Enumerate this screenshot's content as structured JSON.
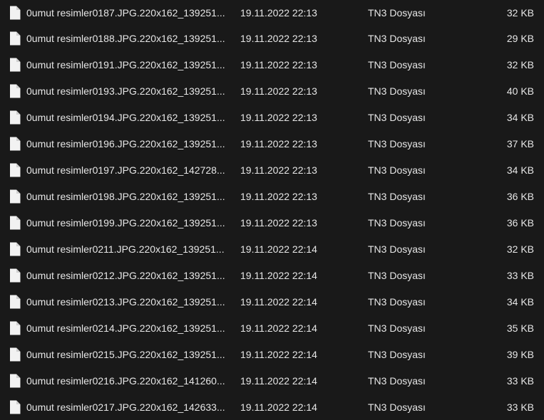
{
  "files": [
    {
      "name": "0umut resimler0187.JPG.220x162_139251...",
      "date": "19.11.2022 22:13",
      "type": "TN3 Dosyası",
      "size": "32 KB",
      "icon": "document-icon"
    },
    {
      "name": "0umut resimler0188.JPG.220x162_139251...",
      "date": "19.11.2022 22:13",
      "type": "TN3 Dosyası",
      "size": "29 KB",
      "icon": "document-icon"
    },
    {
      "name": "0umut resimler0191.JPG.220x162_139251...",
      "date": "19.11.2022 22:13",
      "type": "TN3 Dosyası",
      "size": "32 KB",
      "icon": "document-icon"
    },
    {
      "name": "0umut resimler0193.JPG.220x162_139251...",
      "date": "19.11.2022 22:13",
      "type": "TN3 Dosyası",
      "size": "40 KB",
      "icon": "document-icon"
    },
    {
      "name": "0umut resimler0194.JPG.220x162_139251...",
      "date": "19.11.2022 22:13",
      "type": "TN3 Dosyası",
      "size": "34 KB",
      "icon": "document-icon"
    },
    {
      "name": "0umut resimler0196.JPG.220x162_139251...",
      "date": "19.11.2022 22:13",
      "type": "TN3 Dosyası",
      "size": "37 KB",
      "icon": "document-icon"
    },
    {
      "name": "0umut resimler0197.JPG.220x162_142728...",
      "date": "19.11.2022 22:13",
      "type": "TN3 Dosyası",
      "size": "34 KB",
      "icon": "document-icon"
    },
    {
      "name": "0umut resimler0198.JPG.220x162_139251...",
      "date": "19.11.2022 22:13",
      "type": "TN3 Dosyası",
      "size": "36 KB",
      "icon": "document-icon"
    },
    {
      "name": "0umut resimler0199.JPG.220x162_139251...",
      "date": "19.11.2022 22:13",
      "type": "TN3 Dosyası",
      "size": "36 KB",
      "icon": "document-icon"
    },
    {
      "name": "0umut resimler0211.JPG.220x162_139251...",
      "date": "19.11.2022 22:14",
      "type": "TN3 Dosyası",
      "size": "32 KB",
      "icon": "document-icon"
    },
    {
      "name": "0umut resimler0212.JPG.220x162_139251...",
      "date": "19.11.2022 22:14",
      "type": "TN3 Dosyası",
      "size": "33 KB",
      "icon": "document-icon"
    },
    {
      "name": "0umut resimler0213.JPG.220x162_139251...",
      "date": "19.11.2022 22:14",
      "type": "TN3 Dosyası",
      "size": "34 KB",
      "icon": "document-icon"
    },
    {
      "name": "0umut resimler0214.JPG.220x162_139251...",
      "date": "19.11.2022 22:14",
      "type": "TN3 Dosyası",
      "size": "35 KB",
      "icon": "document-icon"
    },
    {
      "name": "0umut resimler0215.JPG.220x162_139251...",
      "date": "19.11.2022 22:14",
      "type": "TN3 Dosyası",
      "size": "39 KB",
      "icon": "document-icon"
    },
    {
      "name": "0umut resimler0216.JPG.220x162_141260...",
      "date": "19.11.2022 22:14",
      "type": "TN3 Dosyası",
      "size": "33 KB",
      "icon": "document-icon"
    },
    {
      "name": "0umut resimler0217.JPG.220x162_142633...",
      "date": "19.11.2022 22:14",
      "type": "TN3 Dosyası",
      "size": "33 KB",
      "icon": "document-icon"
    }
  ]
}
